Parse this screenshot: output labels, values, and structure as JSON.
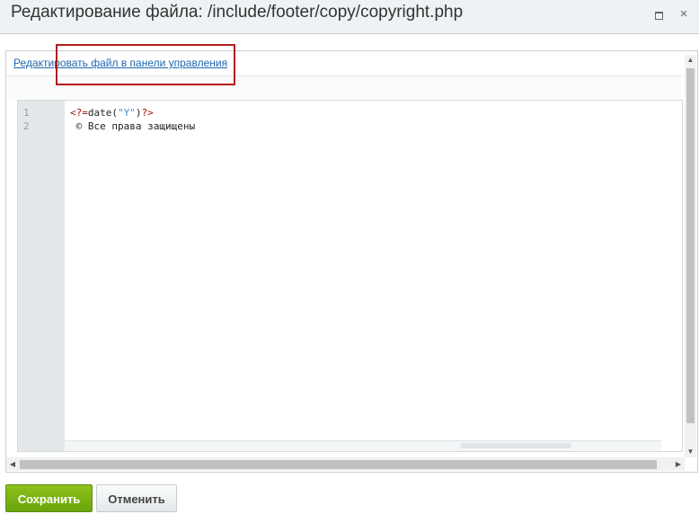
{
  "window": {
    "title": "Редактирование файла: /include/footer/copy/copyright.php",
    "maximize_icon": "maximize-icon",
    "close_glyph": "×"
  },
  "panel": {
    "edit_link": "Редактировать файл в панели управления"
  },
  "editor": {
    "line_numbers": [
      "1",
      "2"
    ],
    "lines": [
      {
        "open": "<?=",
        "fn": "date(",
        "str": "\"Y\"",
        "close_paren": ")",
        "close": "?>"
      },
      {
        "text": " © Все права защищены"
      }
    ]
  },
  "scrollbars": {
    "up": "▲",
    "down": "▼",
    "left": "◀",
    "right": "▶"
  },
  "buttons": {
    "save": "Сохранить",
    "cancel": "Отменить"
  },
  "colors": {
    "save_button": "#7cb316",
    "highlight_border": "#b21d1d",
    "link": "#2067b0",
    "php_tag": "#9b0b0b",
    "string": "#3d8fd0"
  }
}
